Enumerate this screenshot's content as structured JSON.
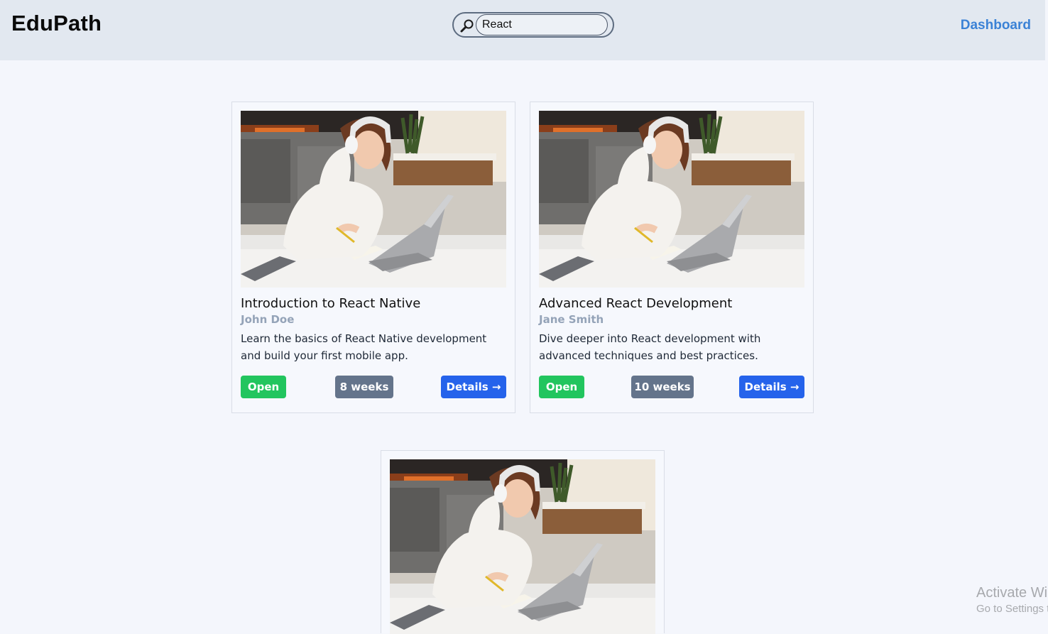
{
  "header": {
    "logo": "EduPath",
    "search": {
      "value": "React",
      "icon": "magnifier-icon"
    },
    "nav_link": "Dashboard"
  },
  "courses": [
    {
      "title": "Introduction to React Native",
      "instructor": "John Doe",
      "description": "Learn the basics of React Native development and build your first mobile app.",
      "status": "Open",
      "duration": "8 weeks",
      "details_label": "Details →"
    },
    {
      "title": "Advanced React Development",
      "instructor": "Jane Smith",
      "description": "Dive deeper into React development with advanced techniques and best practices.",
      "status": "Open",
      "duration": "10 weeks",
      "details_label": "Details →"
    },
    {
      "title": "",
      "instructor": "",
      "description": "",
      "status": "",
      "duration": "",
      "details_label": ""
    }
  ],
  "watermark": {
    "line1": "Activate Wi",
    "line2": "Go to Settings t"
  },
  "colors": {
    "header_bg": "#e2e8f0",
    "page_bg": "#f4f6fc",
    "accent": "#2563eb",
    "open_badge": "#22c55e",
    "duration_badge": "#64748b",
    "link": "#3b82d6"
  }
}
